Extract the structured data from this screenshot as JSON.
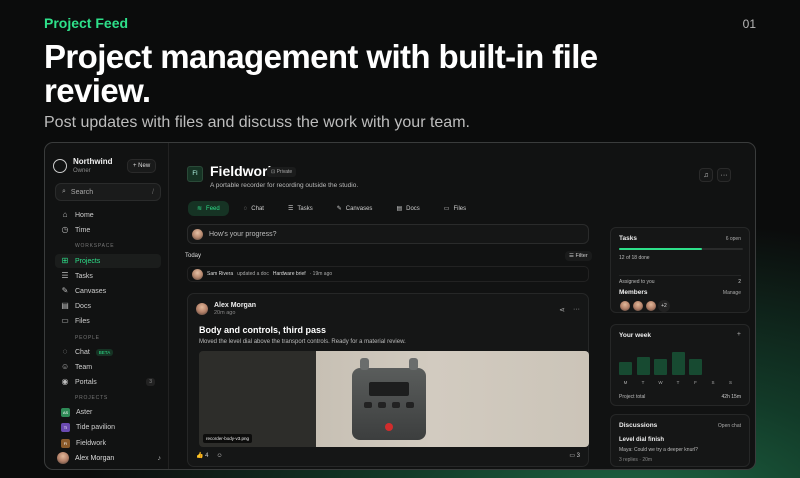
{
  "hero": {
    "kicker": "Project Feed",
    "number": "01",
    "title": "Project management with built-in file review.",
    "subtitle": "Post updates with files and discuss the work with your team."
  },
  "sidebar": {
    "workspace": {
      "name": "Northwind",
      "role": "Owner"
    },
    "new_label": "New",
    "search": {
      "label": "Search",
      "shortcut": "/"
    },
    "top_items": [
      {
        "label": "Home",
        "icon": "home-icon"
      },
      {
        "label": "Time",
        "icon": "clock-icon"
      }
    ],
    "workspace_section": "WORKSPACE",
    "workspace_items": [
      {
        "label": "Projects",
        "icon": "grid-icon",
        "active": true
      },
      {
        "label": "Tasks",
        "icon": "tasks-icon"
      },
      {
        "label": "Canvases",
        "icon": "canvas-icon"
      },
      {
        "label": "Docs",
        "icon": "doc-icon"
      },
      {
        "label": "Files",
        "icon": "folder-icon"
      }
    ],
    "people_section": "PEOPLE",
    "people_items": [
      {
        "label": "Chat",
        "icon": "chat-icon",
        "badge": "BETA"
      },
      {
        "label": "Team",
        "icon": "team-icon"
      },
      {
        "label": "Portals",
        "icon": "portal-icon",
        "count": "3"
      }
    ],
    "projects_section": "PROJECTS",
    "projects": [
      {
        "label": "Aster",
        "initials": "AS",
        "color": "#2e8a56"
      },
      {
        "label": "Tide pavilion",
        "initials": "TI",
        "color": "#6a4ab0"
      },
      {
        "label": "Fieldwork",
        "initials": "FI",
        "color": "#8a5a2a"
      }
    ],
    "user": {
      "name": "Alex Morgan"
    }
  },
  "project": {
    "initials": "FI",
    "title": "Fieldwork",
    "private_label": "Private",
    "description": "A portable recorder for recording outside the studio."
  },
  "tabs": [
    {
      "label": "Feed",
      "icon": "rss-icon",
      "active": true
    },
    {
      "label": "Chat",
      "icon": "chat-icon"
    },
    {
      "label": "Tasks",
      "icon": "tasks-icon"
    },
    {
      "label": "Canvases",
      "icon": "canvas-icon"
    },
    {
      "label": "Docs",
      "icon": "doc-icon"
    },
    {
      "label": "Files",
      "icon": "folder-icon"
    }
  ],
  "feed": {
    "composer_placeholder": "How's your progress?",
    "today_label": "Today",
    "filter_label": "Filter",
    "activity": {
      "actor": "Sam Rivera",
      "action": "updated a doc",
      "target": "Hardware brief",
      "time": "· 19m ago"
    },
    "post": {
      "author": "Alex Morgan",
      "time": "20m ago",
      "title": "Body and controls, third pass",
      "body": "Moved the level dial above the transport controls. Ready for a material review.",
      "attachment": "recorder-body-v3.png",
      "reaction_count": "4",
      "comment_count": "3"
    }
  },
  "panel": {
    "tasks": {
      "title": "Tasks",
      "open": "6 open",
      "progress_text": "12 of 18 done",
      "progress": 0.6667,
      "assigned_label": "Assigned to you",
      "assigned_count": "2"
    },
    "members": {
      "title": "Members",
      "manage": "Manage",
      "extra": "+2"
    },
    "week": {
      "title": "Your week",
      "days": [
        "M",
        "T",
        "W",
        "T",
        "F",
        "S",
        "S"
      ],
      "hours": [
        2.5,
        3.5,
        3,
        4.5,
        3,
        0,
        0
      ],
      "total_label": "Project total",
      "total_value": "42h 15m"
    },
    "discussions": {
      "title": "Discussions",
      "open_chat": "Open chat",
      "item_title": "Level dial finish",
      "item_text": "Maya: Could we try a deeper knurl?",
      "item_meta": "3 replies · 20m"
    }
  }
}
